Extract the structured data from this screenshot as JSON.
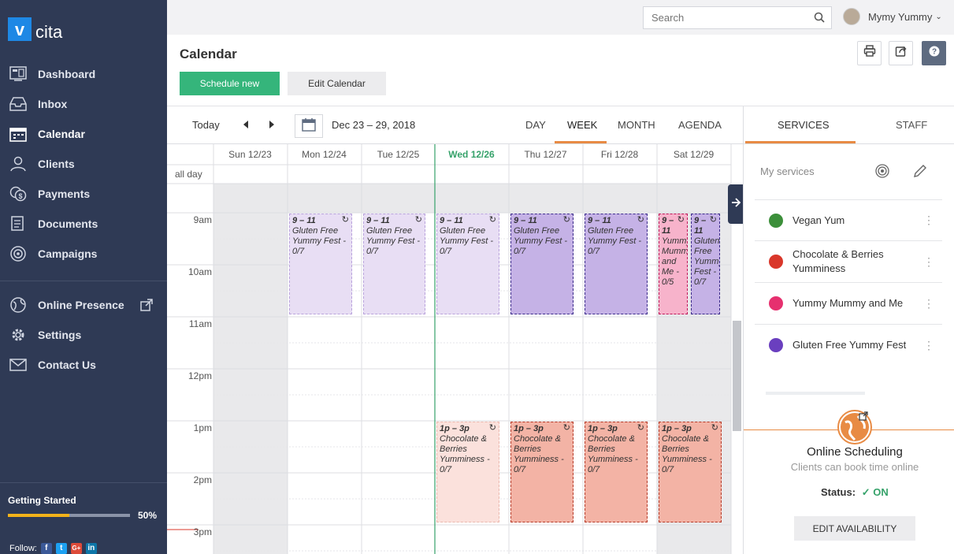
{
  "app": {
    "logo_mark": "v",
    "logo_text": "cita"
  },
  "sidebar": {
    "items": [
      {
        "label": "Dashboard",
        "icon": "dashboard-icon"
      },
      {
        "label": "Inbox",
        "icon": "inbox-icon"
      },
      {
        "label": "Calendar",
        "icon": "calendar-icon",
        "active": true
      },
      {
        "label": "Clients",
        "icon": "clients-icon"
      },
      {
        "label": "Payments",
        "icon": "payments-icon"
      },
      {
        "label": "Documents",
        "icon": "documents-icon"
      },
      {
        "label": "Campaigns",
        "icon": "campaigns-icon"
      }
    ],
    "items2": [
      {
        "label": "Online Presence",
        "icon": "globe-icon"
      },
      {
        "label": "Settings",
        "icon": "gear-icon"
      },
      {
        "label": "Contact Us",
        "icon": "mail-icon"
      }
    ],
    "getting_started": {
      "label": "Getting Started",
      "percent_text": "50%",
      "progress": 0.5
    },
    "follow_label": "Follow:",
    "social": [
      "f",
      "t",
      "G+",
      "in"
    ]
  },
  "topbar": {
    "search_placeholder": "Search",
    "user_name": "Mymy Yummy"
  },
  "header": {
    "title": "Calendar",
    "schedule_new": "Schedule new",
    "edit_calendar": "Edit Calendar"
  },
  "toolbar": {
    "today": "Today",
    "range": "Dec 23 – 29, 2018",
    "views": [
      "DAY",
      "WEEK",
      "MONTH",
      "AGENDA"
    ],
    "active_view": "WEEK"
  },
  "grid": {
    "days": [
      "Sun 12/23",
      "Mon 12/24",
      "Tue 12/25",
      "Wed 12/26",
      "Thu 12/27",
      "Fri 12/28",
      "Sat 12/29"
    ],
    "today_index": 3,
    "allday_label": "all day",
    "hours": [
      "9am",
      "10am",
      "11am",
      "12pm",
      "1pm",
      "2pm",
      "3pm"
    ],
    "events": [
      {
        "day": 1,
        "time": "9 – 11",
        "title": "Gluten Free Yummy Fest - 0/7",
        "color": "gfy",
        "style": "light"
      },
      {
        "day": 2,
        "time": "9 – 11",
        "title": "Gluten Free Yummy Fest - 0/7",
        "color": "gfy",
        "style": "light"
      },
      {
        "day": 3,
        "time": "9 – 11",
        "title": "Gluten Free Yummy Fest - 0/7",
        "color": "gfy",
        "style": "light"
      },
      {
        "day": 4,
        "time": "9 – 11",
        "title": "Gluten Free Yummy Fest - 0/7",
        "color": "gfy",
        "style": "dark"
      },
      {
        "day": 5,
        "time": "9 – 11",
        "title": "Gluten Free Yummy Fest - 0/7",
        "color": "gfy",
        "style": "dark"
      },
      {
        "day": 6,
        "time": "9 – 11",
        "title": "Yummy Mummy and Me - 0/5",
        "color": "ymm",
        "style": "dark",
        "half": 0
      },
      {
        "day": 6,
        "time": "9 – 11",
        "title": "Gluten Free Yummy Fest - 0/7",
        "color": "gfy",
        "style": "dark",
        "half": 1
      },
      {
        "day": 3,
        "time": "1p – 3p",
        "title": "Chocolate & Berries Yumminess - 0/7",
        "color": "cb",
        "style": "light"
      },
      {
        "day": 4,
        "time": "1p – 3p",
        "title": "Chocolate & Berries Yumminess - 0/7",
        "color": "cb",
        "style": "dark"
      },
      {
        "day": 5,
        "time": "1p – 3p",
        "title": "Chocolate & Berries Yumminess - 0/7",
        "color": "cb",
        "style": "dark"
      },
      {
        "day": 6,
        "time": "1p – 3p",
        "title": "Chocolate & Berries Yumminess - 0/7",
        "color": "cb",
        "style": "dark"
      }
    ]
  },
  "panel": {
    "tabs": [
      "SERVICES",
      "STAFF"
    ],
    "my_services": "My services",
    "services": [
      {
        "name": "Vegan Yum",
        "color": "#3c8f3a"
      },
      {
        "name": "Chocolate & Berries Yumminess",
        "color": "#d9372a"
      },
      {
        "name": "Yummy Mummy and Me",
        "color": "#e6306f"
      },
      {
        "name": "Gluten Free Yummy Fest",
        "color": "#6a3fbf"
      }
    ],
    "online_title": "Online Scheduling",
    "online_sub": "Clients can book time online",
    "status_label": "Status:",
    "status_value": "ON",
    "edit_availability": "EDIT AVAILABILITY"
  },
  "colors": {
    "accent": "#e88b44",
    "green": "#35b57b",
    "sidebar": "#2f3a55"
  }
}
